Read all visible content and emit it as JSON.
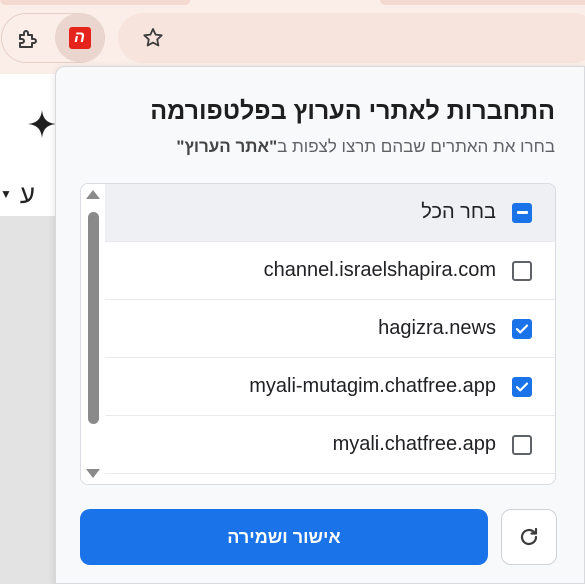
{
  "browser": {
    "extension_logo_text": "ה",
    "icons": {
      "extensions": "puzzle-icon",
      "bookmark": "star-icon"
    }
  },
  "underlying_page": {
    "dropdown_text": "ע"
  },
  "popup": {
    "title": "התחברות לאתרי הערוץ בפלטפורמה",
    "subtitle_prefix": "בחרו את האתרים שבהם תרצו לצפות ב",
    "subtitle_bold": "\"אתר הערוץ\"",
    "select_all_label": "בחר הכל",
    "select_all_state": "mixed",
    "sites": [
      {
        "label": "channel.israelshapira.com",
        "checked": false
      },
      {
        "label": "hagizra.news",
        "checked": true
      },
      {
        "label": "myali-mutagim.chatfree.app",
        "checked": true
      },
      {
        "label": "myali.chatfree.app",
        "checked": false
      }
    ],
    "save_label": "אישור ושמירה",
    "colors": {
      "accent": "#1a73e8",
      "logo": "#e5251d"
    }
  }
}
